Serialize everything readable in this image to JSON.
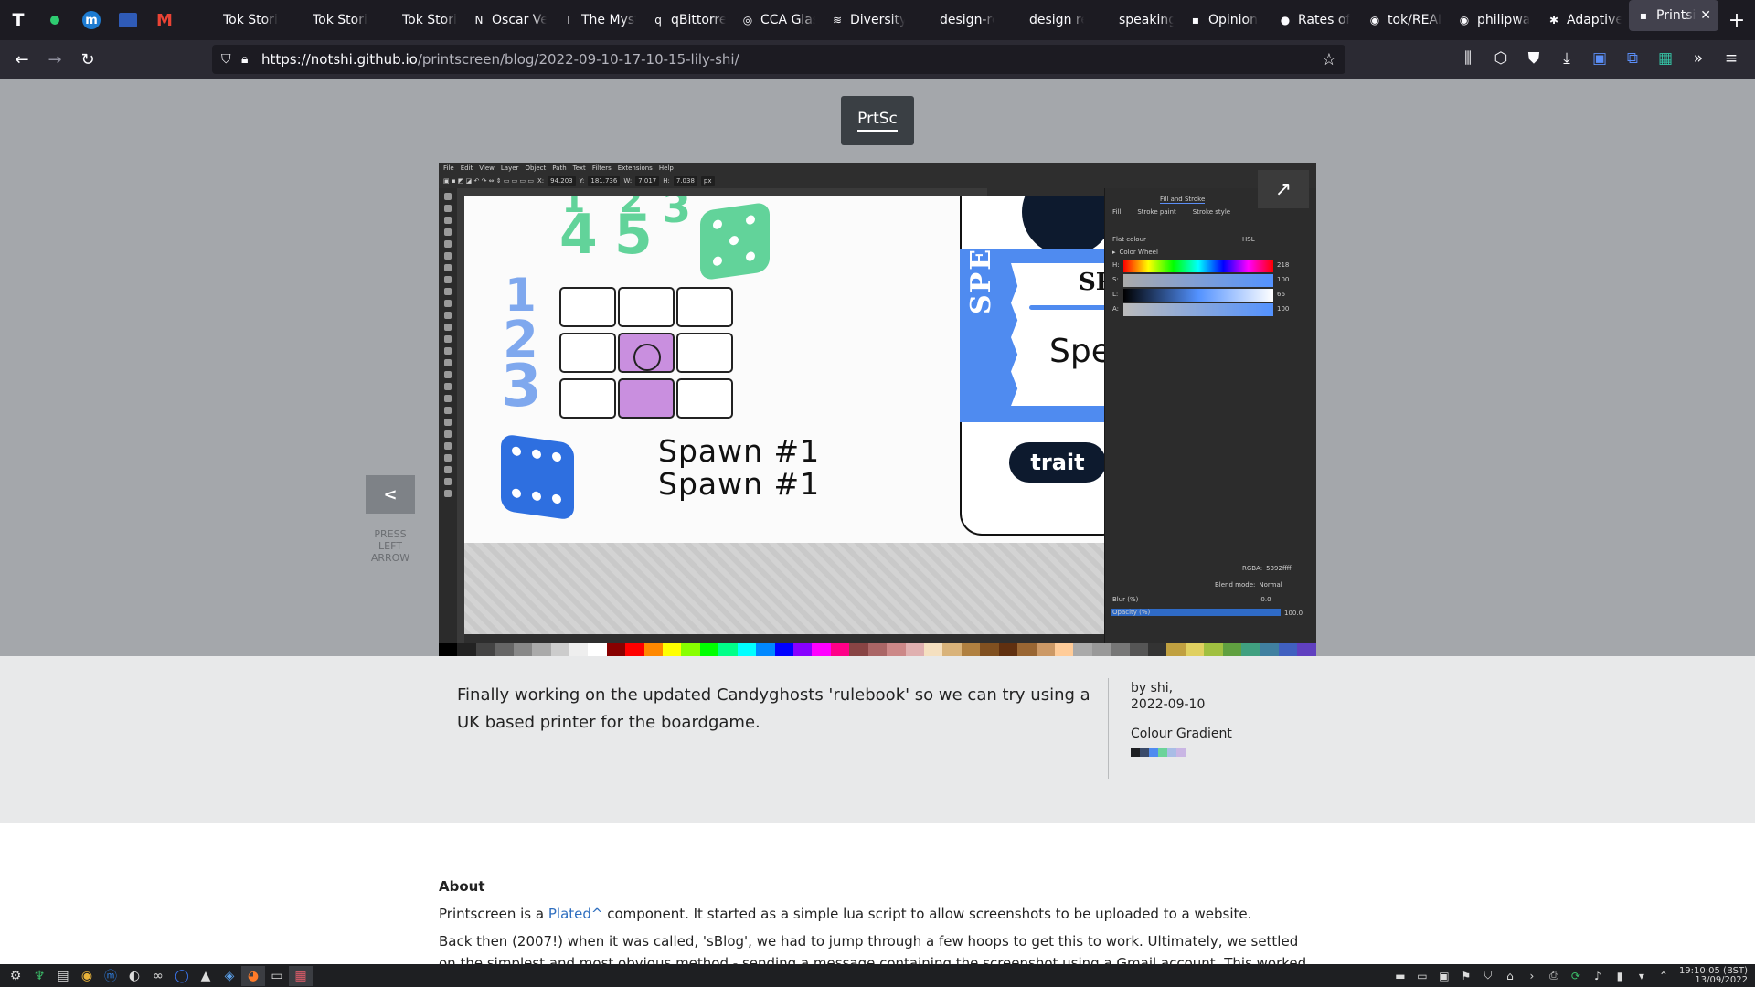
{
  "browser": {
    "pinned_tabs": [
      "typora-icon",
      "green-dot-icon",
      "m-icon",
      "nav-icon",
      "gmail-icon"
    ],
    "tabs": [
      {
        "label": "Tok Stori | F",
        "icon": ""
      },
      {
        "label": "Tok Stori | F",
        "icon": ""
      },
      {
        "label": "Tok Stori | S",
        "icon": ""
      },
      {
        "label": "Oscar Ve",
        "icon": "N"
      },
      {
        "label": "The Myst",
        "icon": "T"
      },
      {
        "label": "qBittorre",
        "icon": "q"
      },
      {
        "label": "CCA Glas",
        "icon": "◎"
      },
      {
        "label": "Diversity",
        "icon": "≋"
      },
      {
        "label": "design-rese",
        "icon": ""
      },
      {
        "label": "design rese",
        "icon": ""
      },
      {
        "label": "speaking-vo",
        "icon": ""
      },
      {
        "label": "Opinion",
        "icon": "▪"
      },
      {
        "label": "Rates of",
        "icon": "●"
      },
      {
        "label": "tok/REAI",
        "icon": "◉"
      },
      {
        "label": "philipwa",
        "icon": "◉"
      },
      {
        "label": "Adaptive",
        "icon": "✱"
      },
      {
        "label": "Printsi",
        "icon": "▪",
        "active": true
      }
    ],
    "url_host": "https://notshi.github.io",
    "url_path": "/printscreen/blog/2022-09-10-17-10-15-lily-shi/"
  },
  "page": {
    "logo": "PrtSc",
    "prev_button": "<",
    "prev_hint": "PRESS LEFT ARROW",
    "description": "Finally working on the updated Candyghosts 'rulebook' so we can try using a UK based printer for the boardgame.",
    "by_prefix": "by",
    "author": "shi,",
    "date": "2022-09-10",
    "gradient_label": "Colour Gradient",
    "gradient_colors": [
      "#1d1f23",
      "#3a4b6a",
      "#4f8bf0",
      "#6bd39a",
      "#a9bde6",
      "#c9b6e4"
    ],
    "about_title": "About",
    "about_p1_pre": "Printscreen is a ",
    "about_p1_link": "Plated^",
    "about_p1_post": " component. It started as a simple lua script to allow screenshots to be uploaded to a website.",
    "about_p2": "Back then (2007!) when it was called, 'sBlog', we had to jump through a few hoops to get this to work. Ultimately, we settled on the simplest and most obvious method - sending a message containing the screenshot using a Gmail account. This worked with any blogging service that"
  },
  "screenshot": {
    "menu": [
      "File",
      "Edit",
      "View",
      "Layer",
      "Object",
      "Path",
      "Text",
      "Filters",
      "Extensions",
      "Help"
    ],
    "toolbar": {
      "x": "94.203",
      "y": "181.736",
      "w": "7.017",
      "h": "7.038",
      "unit": "px"
    },
    "artboard": {
      "top_numbers": [
        "4",
        "5"
      ],
      "small_numbers": [
        "1",
        "2",
        "3"
      ],
      "left_numbers": [
        "1",
        "2",
        "3"
      ],
      "spawn_line1": "Spawn #1",
      "spawn_line2": "Spawn #1",
      "special_vertical": "SPECIAL",
      "special_title": "SP",
      "special_sub": "Spec",
      "trait": "trait"
    },
    "panel": {
      "tabs": [
        "Fill and Stroke"
      ],
      "subtabs": [
        "Fill",
        "Stroke paint",
        "Stroke style"
      ],
      "flat_colour": "Flat colour",
      "mode": "HSL",
      "color_wheel": "Color Wheel",
      "channels": [
        {
          "key": "H:",
          "value": "218"
        },
        {
          "key": "S:",
          "value": "100"
        },
        {
          "key": "L:",
          "value": "66"
        },
        {
          "key": "A:",
          "value": "100"
        }
      ],
      "rgba_label": "RGBA:",
      "rgba": "5392ffff",
      "blend_label": "Blend mode:",
      "blend": "Normal",
      "blur_label": "Blur (%)",
      "blur": "0.0",
      "opacity_label": "Opacity (%)",
      "opacity": "100.0"
    }
  },
  "taskbar": {
    "time": "19:10:05",
    "tz": "(BST)",
    "date": "13/09/2022"
  }
}
